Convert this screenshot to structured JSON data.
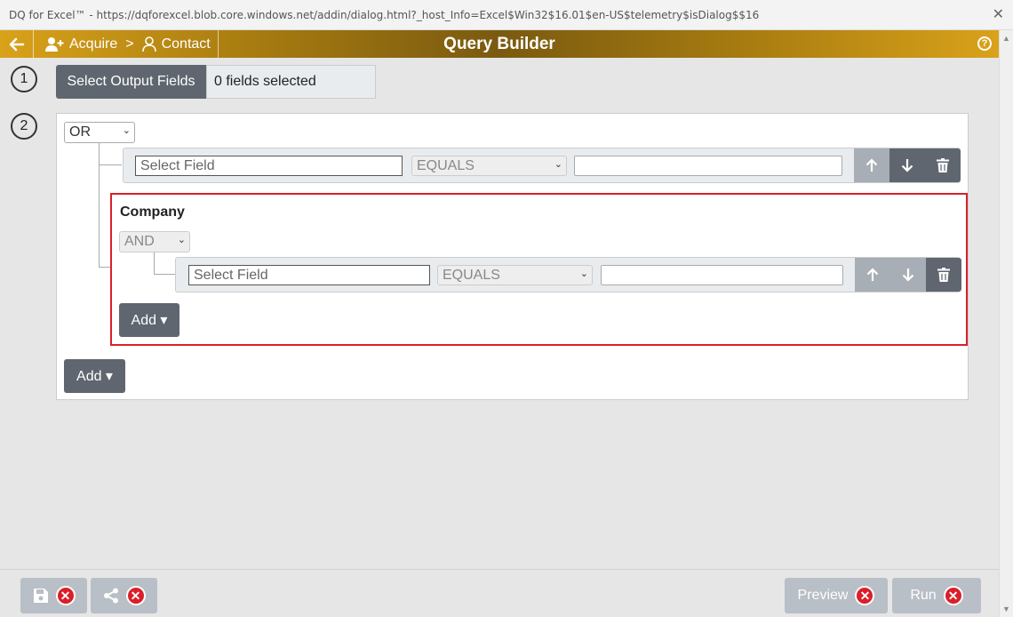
{
  "window": {
    "title": "DQ for Excel™ - https://dqforexcel.blob.core.windows.net/addin/dialog.html?_host_Info=Excel$Win32$16.01$en-US$telemetry$isDialog$$16",
    "close_glyph": "✕"
  },
  "header": {
    "back_icon": "arrow-left-icon",
    "crumb_1": "Acquire",
    "separator": ">",
    "crumb_2": "Contact",
    "title": "Query Builder",
    "help_glyph": "?"
  },
  "step1": {
    "number": "1",
    "button_label": "Select Output Fields",
    "count_text": "0 fields selected"
  },
  "step2": {
    "number": "2",
    "root_condition": "OR",
    "rule1": {
      "field_placeholder": "Select Field",
      "operator": "EQUALS",
      "value": ""
    },
    "group": {
      "title": "Company",
      "condition": "AND",
      "rule": {
        "field_placeholder": "Select Field",
        "operator": "EQUALS",
        "value": ""
      },
      "add_label": "Add ▾"
    },
    "add_label": "Add ▾"
  },
  "footer": {
    "save_icon": "save-icon",
    "share_icon": "share-icon",
    "preview_label": "Preview",
    "run_label": "Run",
    "x_glyph": "✕"
  },
  "colors": {
    "header_gold": "#d9a21a",
    "dark_button": "#5f6670",
    "disabled_button": "#b8bfc6",
    "highlight": "#d9202a"
  }
}
